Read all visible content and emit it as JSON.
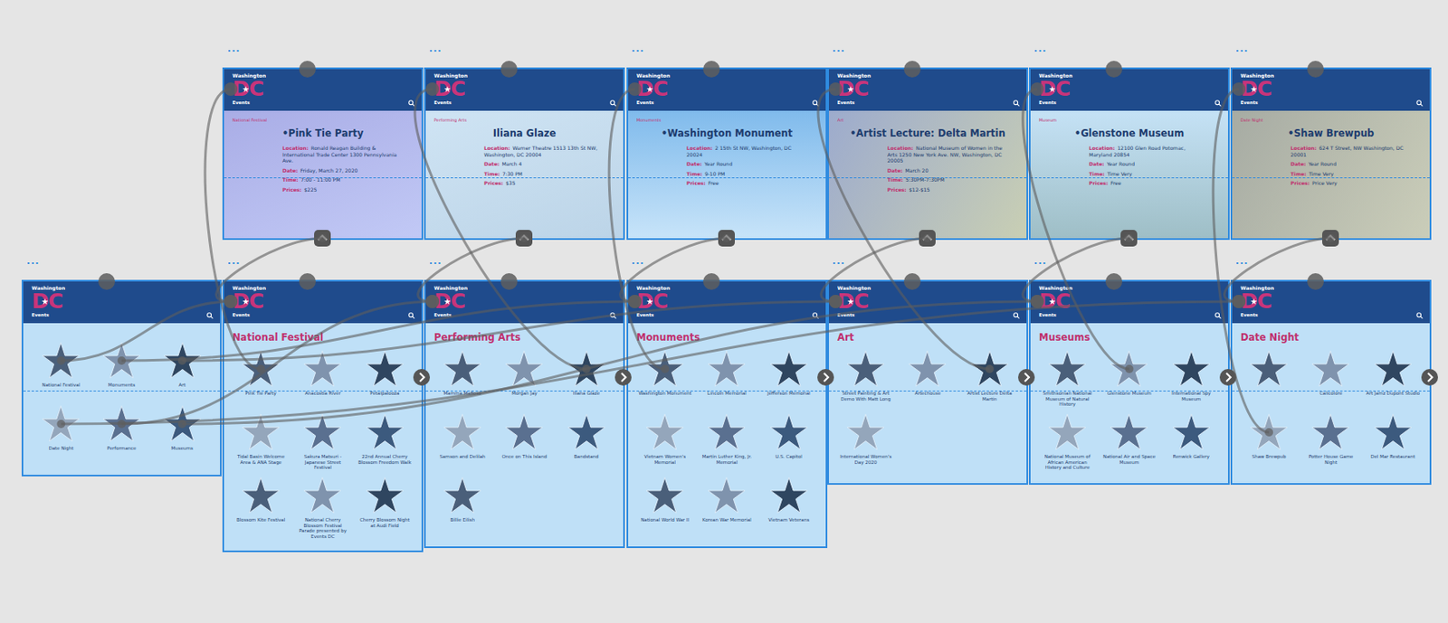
{
  "artboards": [
    {
      "id": "home",
      "kind": "home",
      "dots": "...",
      "brand": {
        "small": "Washington",
        "logo": "DC",
        "sub": "Events"
      },
      "stars": [
        {
          "label": "National Festival"
        },
        {
          "label": "Monuments"
        },
        {
          "label": "Art"
        },
        {
          "label": "Date Night"
        },
        {
          "label": "Performance"
        },
        {
          "label": "Museums"
        }
      ]
    },
    {
      "id": "festival",
      "kind": "category",
      "dots": "...",
      "brand": {
        "small": "Washington",
        "logo": "DC",
        "sub": "Events"
      },
      "title": "National Festival",
      "stars": [
        {
          "label": "Pink Tie Party"
        },
        {
          "label": "Anacostia River"
        },
        {
          "label": "Petalpalooza"
        },
        {
          "label": "Tidal Basin Welcome Area & ANA Stage"
        },
        {
          "label": "Sakura Matsuri - Japanese Street Festival"
        },
        {
          "label": "22nd Annual Cherry Blossom Freedom Walk"
        },
        {
          "label": "Blossom Kite Festival"
        },
        {
          "label": "National Cherry Blossom Festival Parade presented by Events DC"
        },
        {
          "label": "Cherry Blossom Night at Audi Field"
        }
      ]
    },
    {
      "id": "performing",
      "kind": "category",
      "dots": "...",
      "brand": {
        "small": "Washington",
        "logo": "DC",
        "sub": "Events"
      },
      "title": "Performing Arts",
      "stars": [
        {
          "label": "Mamma Mafioso"
        },
        {
          "label": "Morgan Jay"
        },
        {
          "label": "Iliana Glaze"
        },
        {
          "label": "Samson and Delilah"
        },
        {
          "label": "Once on This Island"
        },
        {
          "label": "Bandstand"
        },
        {
          "label": "Billie Eilish"
        }
      ]
    },
    {
      "id": "monuments",
      "kind": "category",
      "dots": "...",
      "brand": {
        "small": "Washington",
        "logo": "DC",
        "sub": "Events"
      },
      "title": "Monuments",
      "stars": [
        {
          "label": "Washington Monument"
        },
        {
          "label": "Lincoln Memorial"
        },
        {
          "label": "Jefferson Memorial"
        },
        {
          "label": "Vietnam Women's Memorial"
        },
        {
          "label": "Martin Luther King, Jr. Memorial"
        },
        {
          "label": "U.S. Capitol"
        },
        {
          "label": "National World War II"
        },
        {
          "label": "Korean War Memorial"
        },
        {
          "label": "Vietnam Veterans"
        }
      ]
    },
    {
      "id": "art",
      "kind": "category",
      "dots": "...",
      "brand": {
        "small": "Washington",
        "logo": "DC",
        "sub": "Events"
      },
      "title": "Art",
      "stars": [
        {
          "label": "Street Painting & Art Demo With Matt Long"
        },
        {
          "label": "Artechouse"
        },
        {
          "label": "Artist Lecture Delta Martin"
        },
        {
          "label": "International Women's Day 2020"
        }
      ]
    },
    {
      "id": "museums",
      "kind": "category",
      "dots": "...",
      "brand": {
        "small": "Washington",
        "logo": "DC",
        "sub": "Events"
      },
      "title": "Museums",
      "stars": [
        {
          "label": "Smithsonian National Museum of Natural History"
        },
        {
          "label": "Glenstone Museum"
        },
        {
          "label": "International Spy Museum"
        },
        {
          "label": "National Museum of African American History and Culture"
        },
        {
          "label": "National Air and Space Museum"
        },
        {
          "label": "Renwick Gallery"
        }
      ]
    },
    {
      "id": "date",
      "kind": "category",
      "dots": "...",
      "brand": {
        "small": "Washington",
        "logo": "DC",
        "sub": "Events"
      },
      "title": "Date Night",
      "stars": [
        {
          "label": ""
        },
        {
          "label": "Calicolore"
        },
        {
          "label": "Art Jamz Dupont Studio"
        },
        {
          "label": "Shaw Brewpub"
        },
        {
          "label": "Potter House Game Night"
        },
        {
          "label": "Del Mar Restaurant"
        }
      ]
    },
    {
      "id": "pinktie",
      "kind": "detail",
      "dots": "...",
      "brand": {
        "small": "Washington",
        "logo": "DC",
        "sub": "Events"
      },
      "tag": "National Festival",
      "title": "•Pink Tie Party",
      "details": [
        {
          "label": "Location:",
          "value": "Ronald Reagan Building & International Trade Center 1300 Pennsylvania Ave."
        },
        {
          "label": "Date:",
          "value": "Friday, March 27, 2020"
        },
        {
          "label": "Time:",
          "value": "7:00 - 11:00 PM"
        },
        {
          "label": "Prices:",
          "value": "$225"
        }
      ]
    },
    {
      "id": "iliana",
      "kind": "detail",
      "dots": "...",
      "brand": {
        "small": "Washington",
        "logo": "DC",
        "sub": "Events"
      },
      "tag": "Performing Arts",
      "title": "Iliana Glaze",
      "details": [
        {
          "label": "Location:",
          "value": "Warner Theatre 1513 13th St NW, Washington, DC 20004"
        },
        {
          "label": "Date:",
          "value": "March 4"
        },
        {
          "label": "Time:",
          "value": "7:30 PM"
        },
        {
          "label": "Prices:",
          "value": "$35"
        }
      ]
    },
    {
      "id": "monument",
      "kind": "detail",
      "dots": "...",
      "brand": {
        "small": "Washington",
        "logo": "DC",
        "sub": "Events"
      },
      "tag": "Monuments",
      "title": "•Washington Monument",
      "details": [
        {
          "label": "Location:",
          "value": "2 15th St NW, Washington, DC 20024"
        },
        {
          "label": "Date:",
          "value": "Year Round"
        },
        {
          "label": "Time:",
          "value": "9-10 PM"
        },
        {
          "label": "Prices:",
          "value": "Free"
        }
      ]
    },
    {
      "id": "lecture",
      "kind": "detail",
      "dots": "...",
      "brand": {
        "small": "Washington",
        "logo": "DC",
        "sub": "Events"
      },
      "tag": "Art",
      "title": "•Artist Lecture: Delta Martin",
      "details": [
        {
          "label": "Location:",
          "value": "National Museum of Women in the Arts 1250 New York Ave. NW, Washington, DC 20005"
        },
        {
          "label": "Date:",
          "value": "March 20"
        },
        {
          "label": "Time:",
          "value": "5:30PM-7:30PM"
        },
        {
          "label": "Prices:",
          "value": "$12-$15"
        }
      ]
    },
    {
      "id": "glenstone",
      "kind": "detail",
      "dots": "...",
      "brand": {
        "small": "Washington",
        "logo": "DC",
        "sub": "Events"
      },
      "tag": "Museum",
      "title": "•Glenstone Museum",
      "details": [
        {
          "label": "Location:",
          "value": "12100 Glen Road Potomac, Maryland 20854"
        },
        {
          "label": "Date:",
          "value": "Year Round"
        },
        {
          "label": "Time:",
          "value": "Time Very"
        },
        {
          "label": "Prices:",
          "value": "Free"
        }
      ]
    },
    {
      "id": "shaw",
      "kind": "detail",
      "dots": "...",
      "brand": {
        "small": "Washington",
        "logo": "DC",
        "sub": "Events"
      },
      "tag": "Date Night",
      "title": "•Shaw Brewpub",
      "details": [
        {
          "label": "Location:",
          "value": "624 T Street, NW Washington, DC 20001"
        },
        {
          "label": "Date:",
          "value": "Year Round"
        },
        {
          "label": "Time:",
          "value": "Time Very"
        },
        {
          "label": "Prices:",
          "value": "Price Very"
        }
      ]
    }
  ],
  "links": [
    {
      "from": "home",
      "star": 0,
      "to": "festival"
    },
    {
      "from": "home",
      "star": 1,
      "to": "monuments"
    },
    {
      "from": "home",
      "star": 2,
      "to": "art"
    },
    {
      "from": "home",
      "star": 3,
      "to": "date"
    },
    {
      "from": "home",
      "star": 4,
      "to": "performing"
    },
    {
      "from": "home",
      "star": 5,
      "to": "museums"
    },
    {
      "from": "festival",
      "star": 0,
      "to": "pinktie"
    },
    {
      "from": "performing",
      "star": 2,
      "to": "iliana"
    },
    {
      "from": "monuments",
      "star": 0,
      "to": "monument"
    },
    {
      "from": "art",
      "star": 2,
      "to": "lecture"
    },
    {
      "from": "museums",
      "star": 1,
      "to": "glenstone"
    },
    {
      "from": "date",
      "star": 3,
      "to": "shaw"
    },
    {
      "from": "pinktie",
      "to": "festival"
    },
    {
      "from": "iliana",
      "to": "performing"
    },
    {
      "from": "monument",
      "to": "monuments"
    },
    {
      "from": "lecture",
      "to": "art"
    },
    {
      "from": "glenstone",
      "to": "museums"
    },
    {
      "from": "shaw",
      "to": "date"
    }
  ]
}
